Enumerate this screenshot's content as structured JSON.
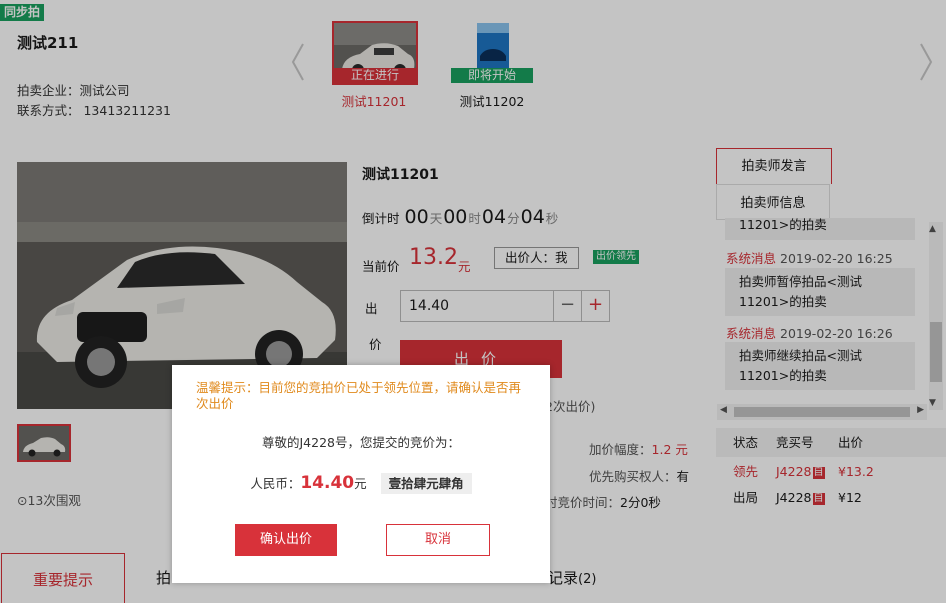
{
  "header": {
    "tag": "同步拍",
    "title": "测试211",
    "company": "拍卖企业：测试公司",
    "contact": "联系方式： 13413211231",
    "items": [
      {
        "status": "正在进行",
        "name": "测试11201",
        "status_color": "#d8323a"
      },
      {
        "status": "即将开始",
        "name": "测试11202",
        "status_color": "#19a15f"
      }
    ]
  },
  "product": {
    "title": "测试11201",
    "countdown": {
      "label": "倒计时",
      "days": "00",
      "days_unit": "天",
      "hours": "00",
      "hours_unit": "时",
      "minutes": "04",
      "minutes_unit": "分",
      "seconds": "04",
      "seconds_unit": "秒"
    },
    "current_price_label": "当前价",
    "current_price": "13.2",
    "price_unit": "元",
    "bidder": "出价人：我",
    "lead_badge": "出价领先",
    "bid_label_1": "出",
    "bid_label_2": "价",
    "bid_value": "14.40",
    "minus": "−",
    "plus": "+",
    "bid_button": "出价",
    "bid_count_fragment": "2次出价)",
    "increment_label": "加价幅度：",
    "increment_value": "1.2 元",
    "priority_label": "优先购买权人：",
    "priority_value": "有",
    "delay_label": "时竞价时间：",
    "delay_value": "2分0秒",
    "watchers": "13次围观"
  },
  "side": {
    "tab1": "拍卖师发言",
    "tab2": "拍卖师信息",
    "partial_msg": "11201>的拍卖",
    "messages": [
      {
        "type": "系统消息",
        "time": "2019-02-20 16:25",
        "line1": "拍卖师暂停拍品<测试",
        "line2": "11201>的拍卖"
      },
      {
        "type": "系统消息",
        "time": "2019-02-20 16:26",
        "line1": "拍卖师继续拍品<测试",
        "line2": "11201>的拍卖"
      }
    ],
    "table": {
      "headers": [
        "状态",
        "竞买号",
        "出价"
      ],
      "rows": [
        {
          "status": "领先",
          "bidder": "J4228",
          "mark": "自",
          "price": "¥13.2",
          "highlight": true
        },
        {
          "status": "出局",
          "bidder": "J4228",
          "mark": "自",
          "price": "¥12",
          "highlight": false
        }
      ]
    }
  },
  "bottom_tabs": {
    "active": "重要提示",
    "frag1": "拍",
    "frag2": "记录",
    "frag2_count": "(2)"
  },
  "modal": {
    "warning": "温馨提示：目前您的竞拍价已处于领先位置，请确认是否再次出价",
    "greeting": "尊敬的J4228号，您提交的竞价为：",
    "rmb_label": "人民币：",
    "amount": "14.40",
    "amount_unit": "元",
    "uppercase": "壹拾肆元肆角",
    "confirm": "确认出价",
    "cancel": "取消"
  }
}
